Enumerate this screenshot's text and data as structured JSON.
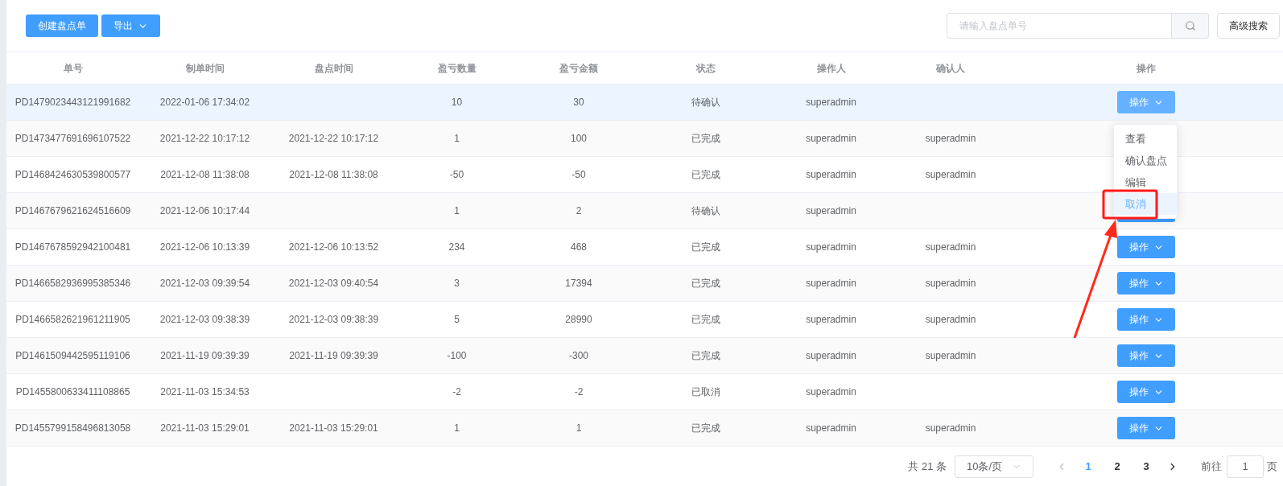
{
  "toolbar": {
    "buttons": [
      {
        "label": "创建盘点单",
        "dropdown": false
      },
      {
        "label": "导出",
        "dropdown": true
      }
    ],
    "search": {
      "placeholder": "请输入盘点单号"
    },
    "advanced_search": "高级搜索"
  },
  "table": {
    "columns": [
      "单号",
      "制单时间",
      "盘点时间",
      "盈亏数量",
      "盈亏金额",
      "状态",
      "操作人",
      "确认人",
      "操作"
    ],
    "rows": [
      {
        "cells": [
          "PD1479023443121991682",
          "2022-01-06 17:34:02",
          "",
          "10",
          "30",
          "待确认",
          "superadmin",
          ""
        ],
        "action": "操作",
        "highlighted": true
      },
      {
        "cells": [
          "PD1473477691696107522",
          "2021-12-22 10:17:12",
          "2021-12-22 10:17:12",
          "1",
          "100",
          "已完成",
          "superadmin",
          "superadmin"
        ],
        "action": null,
        "highlighted": false
      },
      {
        "cells": [
          "PD1468424630539800577",
          "2021-12-08 11:38:08",
          "2021-12-08 11:38:08",
          "-50",
          "-50",
          "已完成",
          "superadmin",
          "superadmin"
        ],
        "action": null,
        "highlighted": false
      },
      {
        "cells": [
          "PD1467679621624516609",
          "2021-12-06 10:17:44",
          "",
          "1",
          "2",
          "待确认",
          "superadmin",
          ""
        ],
        "action": null,
        "highlighted": false
      },
      {
        "cells": [
          "PD1467678592942100481",
          "2021-12-06 10:13:39",
          "2021-12-06 10:13:52",
          "234",
          "468",
          "已完成",
          "superadmin",
          "superadmin"
        ],
        "action": "操作",
        "highlighted": false
      },
      {
        "cells": [
          "PD1466582936995385346",
          "2021-12-03 09:39:54",
          "2021-12-03 09:40:54",
          "3",
          "17394",
          "已完成",
          "superadmin",
          "superadmin"
        ],
        "action": "操作",
        "highlighted": false
      },
      {
        "cells": [
          "PD1466582621961211905",
          "2021-12-03 09:38:39",
          "2021-12-03 09:38:39",
          "5",
          "28990",
          "已完成",
          "superadmin",
          "superadmin"
        ],
        "action": "操作",
        "highlighted": false
      },
      {
        "cells": [
          "PD1461509442595119106",
          "2021-11-19 09:39:39",
          "2021-11-19 09:39:39",
          "-100",
          "-300",
          "已完成",
          "superadmin",
          "superadmin"
        ],
        "action": "操作",
        "highlighted": false
      },
      {
        "cells": [
          "PD1455800633411108865",
          "2021-11-03 15:34:53",
          "",
          "-2",
          "-2",
          "已取消",
          "superadmin",
          ""
        ],
        "action": "操作",
        "highlighted": false
      },
      {
        "cells": [
          "PD1455799158496813058",
          "2021-11-03 15:29:01",
          "2021-11-03 15:29:01",
          "1",
          "1",
          "已完成",
          "superadmin",
          "superadmin"
        ],
        "action": "操作",
        "highlighted": false
      }
    ]
  },
  "action_menu": {
    "items": [
      {
        "label": "查看",
        "selected": false
      },
      {
        "label": "确认盘点",
        "selected": false
      },
      {
        "label": "编辑",
        "selected": false
      },
      {
        "label": "取消",
        "selected": true
      }
    ]
  },
  "pagination": {
    "total": "共 21 条",
    "page_size": "10条/页",
    "pages": [
      {
        "label": "1",
        "selected": true
      },
      {
        "label": "2",
        "selected": false
      },
      {
        "label": "3",
        "selected": false
      }
    ],
    "goto_label": "前往",
    "goto_value": "1",
    "goto_suffix": "页"
  }
}
